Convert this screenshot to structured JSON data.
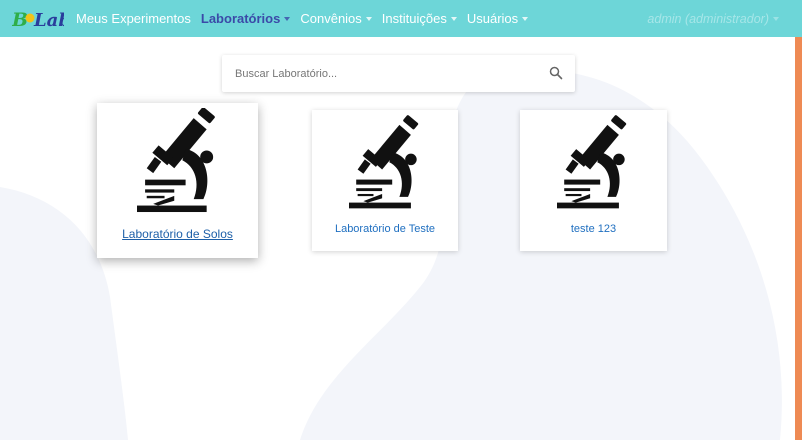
{
  "navbar": {
    "brand": "BioLab",
    "items": [
      {
        "label": "Meus Experimentos",
        "dropdown": false,
        "active": false
      },
      {
        "label": "Laboratórios",
        "dropdown": true,
        "active": true
      },
      {
        "label": "Convênios",
        "dropdown": true,
        "active": false
      },
      {
        "label": "Instituições",
        "dropdown": true,
        "active": false
      },
      {
        "label": "Usuários",
        "dropdown": true,
        "active": false
      }
    ],
    "user": "admin (administrador)"
  },
  "search": {
    "placeholder": "Buscar Laboratório..."
  },
  "labs": [
    {
      "name": "Laboratório de Solos",
      "icon": "microscope-icon"
    },
    {
      "name": "Laboratório de Teste",
      "icon": "microscope-icon"
    },
    {
      "name": "teste 123",
      "icon": "microscope-icon"
    }
  ],
  "colors": {
    "navbar": "#6dd6d8",
    "active_nav": "#3b4aa8",
    "link": "#1f6fc0",
    "accent_edge": "#ee8a54"
  }
}
